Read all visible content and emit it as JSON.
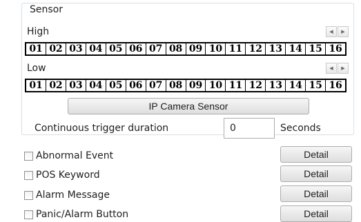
{
  "sensor": {
    "title": "Sensor",
    "high": {
      "label": "High",
      "channels": [
        "01",
        "02",
        "03",
        "04",
        "05",
        "06",
        "07",
        "08",
        "09",
        "10",
        "11",
        "12",
        "13",
        "14",
        "15",
        "16"
      ]
    },
    "low": {
      "label": "Low",
      "channels": [
        "01",
        "02",
        "03",
        "04",
        "05",
        "06",
        "07",
        "08",
        "09",
        "10",
        "11",
        "12",
        "13",
        "14",
        "15",
        "16"
      ]
    },
    "spinner_left_icon": "arrow-left-icon",
    "spinner_right_icon": "arrow-right-icon",
    "ip_camera_button": "IP Camera Sensor",
    "trigger": {
      "label": "Continuous trigger duration",
      "value": "0",
      "unit": "Seconds"
    }
  },
  "events": [
    {
      "label": "Abnormal Event",
      "checked": false,
      "button": "Detail"
    },
    {
      "label": "POS Keyword",
      "checked": false,
      "button": "Detail"
    },
    {
      "label": "Alarm Message",
      "checked": false,
      "button": "Detail"
    },
    {
      "label": "Panic/Alarm Button",
      "checked": false,
      "button": "Detail"
    }
  ]
}
